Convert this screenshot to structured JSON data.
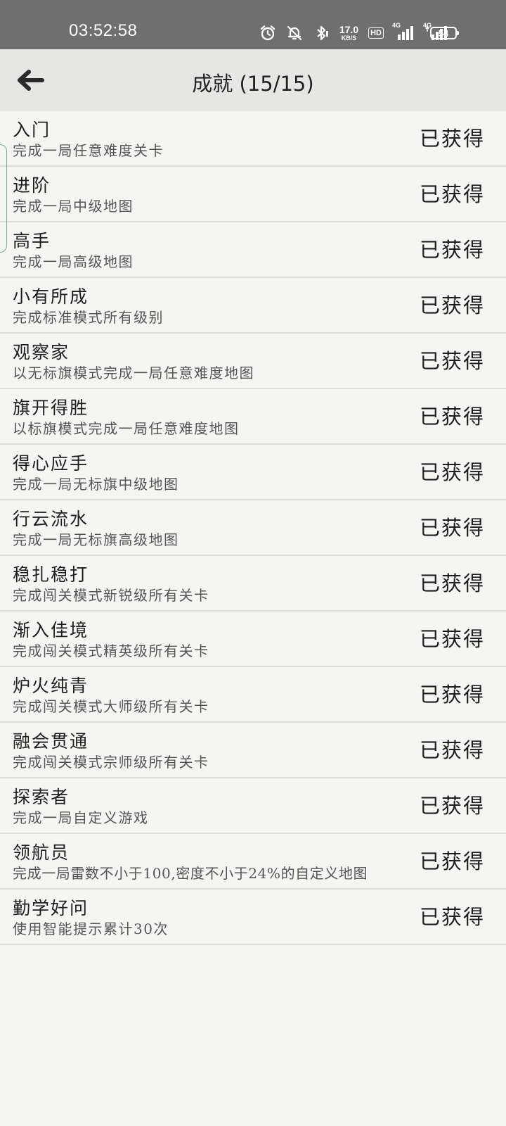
{
  "status_bar": {
    "time": "03:52:58",
    "net_speed_value": "17.0",
    "net_speed_unit": "KB/S",
    "hd_label": "HD",
    "signal1_label": "4G",
    "signal2_label": "4G",
    "battery_level": "54",
    "icons": [
      "alarm-icon",
      "mute-bell-icon",
      "bluetooth-icon",
      "hd-volte-icon",
      "signal-icon",
      "signal-icon",
      "battery-icon"
    ]
  },
  "header": {
    "title": "成就 (15/15)",
    "back_icon": "arrow-left-icon"
  },
  "achievements": [
    {
      "name": "入门",
      "desc": "完成一局任意难度关卡",
      "status": "已获得"
    },
    {
      "name": "进阶",
      "desc": "完成一局中级地图",
      "status": "已获得"
    },
    {
      "name": "高手",
      "desc": "完成一局高级地图",
      "status": "已获得"
    },
    {
      "name": "小有所成",
      "desc": "完成标准模式所有级别",
      "status": "已获得"
    },
    {
      "name": "观察家",
      "desc": "以无标旗模式完成一局任意难度地图",
      "status": "已获得"
    },
    {
      "name": "旗开得胜",
      "desc": "以标旗模式完成一局任意难度地图",
      "status": "已获得"
    },
    {
      "name": "得心应手",
      "desc": "完成一局无标旗中级地图",
      "status": "已获得"
    },
    {
      "name": "行云流水",
      "desc": "完成一局无标旗高级地图",
      "status": "已获得"
    },
    {
      "name": "稳扎稳打",
      "desc": "完成闯关模式新锐级所有关卡",
      "status": "已获得"
    },
    {
      "name": "渐入佳境",
      "desc": "完成闯关模式精英级所有关卡",
      "status": "已获得"
    },
    {
      "name": "炉火纯青",
      "desc": "完成闯关模式大师级所有关卡",
      "status": "已获得"
    },
    {
      "name": "融会贯通",
      "desc": "完成闯关模式宗师级所有关卡",
      "status": "已获得"
    },
    {
      "name": "探索者",
      "desc": "完成一局自定义游戏",
      "status": "已获得"
    },
    {
      "name": "领航员",
      "desc": "完成一局雷数不小于100,密度不小于24%的自定义地图",
      "status": "已获得"
    },
    {
      "name": "勤学好问",
      "desc": "使用智能提示累计30次",
      "status": "已获得"
    }
  ]
}
